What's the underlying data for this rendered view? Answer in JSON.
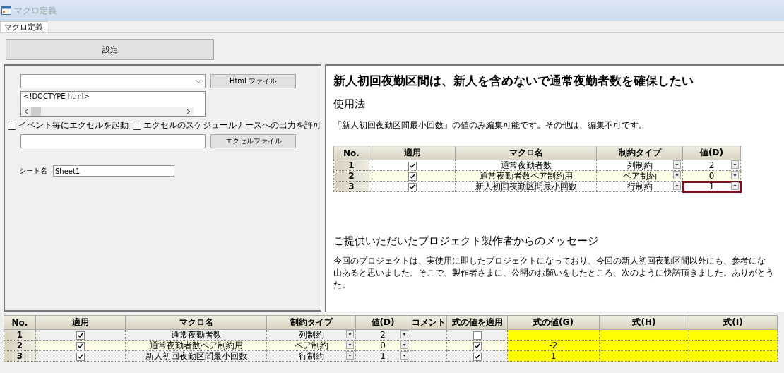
{
  "window": {
    "title": "マクロ定義"
  },
  "tabs": [
    {
      "label": "マクロ定義",
      "selected": true
    }
  ],
  "settings_button": "設定",
  "left_panel": {
    "html_button": "Html ファイル",
    "html_text": "<!DOCTYPE html>",
    "checkboxes": [
      {
        "label": "イベント毎にエクセルを起動",
        "checked": false
      },
      {
        "label": "エクセルのスケジュールナースへの出力を許可",
        "checked": false
      }
    ],
    "excel_button": "エクセルファイル",
    "sheet_label": "シート名",
    "sheet_value": "Sheet1"
  },
  "doc": {
    "heading": "新人初回夜勤区間は、新人を含めないで通常夜勤者数を確保したい",
    "usage_title": "使用法",
    "usage_text": "「新人初回夜勤区間最小回数」の値のみ編集可能です。その他は、編集不可です。",
    "table": {
      "columns": [
        "No.",
        "適用",
        "マクロ名",
        "制約タイプ",
        "値(D)"
      ],
      "rows": [
        {
          "no": "1",
          "checked": true,
          "name": "通常夜勤者数",
          "type": "列制約",
          "value": "2",
          "highlighted": false
        },
        {
          "no": "2",
          "checked": true,
          "name": "通常夜勤者数ペア制約用",
          "type": "ペア制約",
          "value": "0",
          "highlighted": false
        },
        {
          "no": "3",
          "checked": true,
          "name": "新人初回夜勤区間最小回数",
          "type": "行制約",
          "value": "1",
          "highlighted": true
        }
      ]
    },
    "message_title": "ご提供いただいたプロジェクト製作者からのメッセージ",
    "message_lines": [
      "今回のプロジェクトは、実使用に即したプロジェクトになっており、今回の新人初回夜勤区間以外にも、参考にな",
      "山あると思いました。そこで、製作者さまに、公開のお願いをしたところ、次のように快諾頂きました。ありがとう",
      "た。"
    ]
  },
  "grid": {
    "columns": [
      "No.",
      "適用",
      "マクロ名",
      "制約タイプ",
      "値(D)",
      "コメント",
      "式の値を適用",
      "式の値(G)",
      "式(H)",
      "式(I)"
    ],
    "rows": [
      {
        "no": "1",
        "checked": true,
        "name": "通常夜勤者数",
        "type": "列制約",
        "value": "2",
        "formula_applied": false,
        "formula_value": ""
      },
      {
        "no": "2",
        "checked": true,
        "name": "通常夜勤者数ペア制約用",
        "type": "ペア制約",
        "value": "0",
        "formula_applied": true,
        "formula_value": "-2"
      },
      {
        "no": "3",
        "checked": true,
        "name": "新人初回夜勤区間最小回数",
        "type": "行制約",
        "value": "1",
        "formula_applied": true,
        "formula_value": "1"
      }
    ]
  }
}
